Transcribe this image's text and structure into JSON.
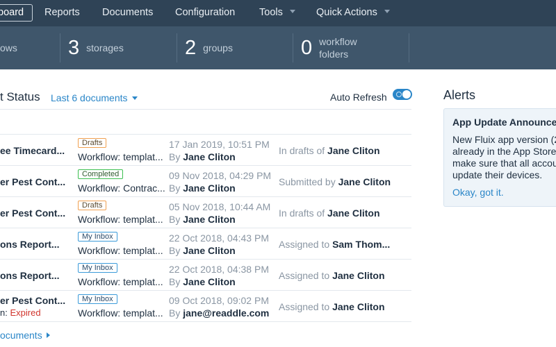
{
  "nav": {
    "items": [
      {
        "label": "board",
        "active": true
      },
      {
        "label": "Reports"
      },
      {
        "label": "Documents"
      },
      {
        "label": "Configuration"
      },
      {
        "label": "Tools",
        "dropdown": true
      },
      {
        "label": "Quick Actions",
        "dropdown": true
      }
    ]
  },
  "stats": [
    {
      "num": "",
      "label1": "ows",
      "label2": ""
    },
    {
      "num": "3",
      "label1": "storages",
      "label2": ""
    },
    {
      "num": "2",
      "label1": "groups",
      "label2": ""
    },
    {
      "num": "0",
      "label1": "workflow",
      "label2": "folders"
    }
  ],
  "panel": {
    "title": "t Status",
    "filter": "Last 6 documents",
    "auto_refresh_label": "Auto Refresh",
    "auto_refresh_on": true,
    "footer_link": "ocuments"
  },
  "rows": [
    {
      "name": "ee Timecard...",
      "sub": "",
      "sub_status": "",
      "badge": "Drafts",
      "badge_type": "drafts",
      "workflow": "Workflow: templat...",
      "date": "17 Jan 2019, 10:51 PM",
      "by_prefix": "By",
      "by": "Jane Cliton",
      "status_text": "In drafts of",
      "status_user": "Jane Cliton"
    },
    {
      "name": "er Pest Cont...",
      "sub": "",
      "sub_status": "",
      "badge": "Completed",
      "badge_type": "completed",
      "workflow": "Workflow: Contrac...",
      "date": "09 Nov 2018, 04:29 PM",
      "by_prefix": "By",
      "by": "Jane Cliton",
      "status_text": "Submitted by",
      "status_user": "Jane Cliton"
    },
    {
      "name": "er Pest Cont...",
      "sub": "",
      "sub_status": "",
      "badge": "Drafts",
      "badge_type": "drafts",
      "workflow": "Workflow: templat...",
      "date": "05 Nov 2018, 10:44 AM",
      "by_prefix": "By",
      "by": "Jane Cliton",
      "status_text": "In drafts of",
      "status_user": "Jane Cliton"
    },
    {
      "name": "ons Report...",
      "sub": "",
      "sub_status": "",
      "badge": "My Inbox",
      "badge_type": "inbox",
      "workflow": "Workflow: templat...",
      "date": "22 Oct 2018, 04:43 PM",
      "by_prefix": "By",
      "by": "Jane Cliton",
      "status_text": "Assigned to",
      "status_user": "Sam Thom..."
    },
    {
      "name": "ons Report...",
      "sub": "",
      "sub_status": "",
      "badge": "My Inbox",
      "badge_type": "inbox",
      "workflow": "Workflow: templat...",
      "date": "22 Oct 2018, 04:38 PM",
      "by_prefix": "By",
      "by": "Jane Cliton",
      "status_text": "Assigned to",
      "status_user": "Jane Cliton"
    },
    {
      "name": "er Pest Cont...",
      "sub": "n: ",
      "sub_status": "Expired",
      "badge": "My Inbox",
      "badge_type": "inbox",
      "workflow": "Workflow: templat...",
      "date": "09 Oct 2018, 09:02 PM",
      "by_prefix": "By",
      "by": "jane@readdle.com",
      "status_text": "Assigned to",
      "status_user": "Jane Cliton"
    }
  ],
  "alerts": {
    "title": "Alerts",
    "heading": "App Update Announcer",
    "body_lines": [
      "New Fluix app version (2",
      "already in the App Store",
      "make sure that all accou",
      "update their devices."
    ],
    "action": "Okay, got it."
  },
  "colors": {
    "nav_bg": "#2f4356",
    "stats_bg": "#3f566b",
    "accent": "#2a86c8",
    "expired": "#d0342c",
    "badge_drafts": "#f0a050",
    "badge_completed": "#3cbf50",
    "badge_inbox": "#3a9ad9"
  }
}
